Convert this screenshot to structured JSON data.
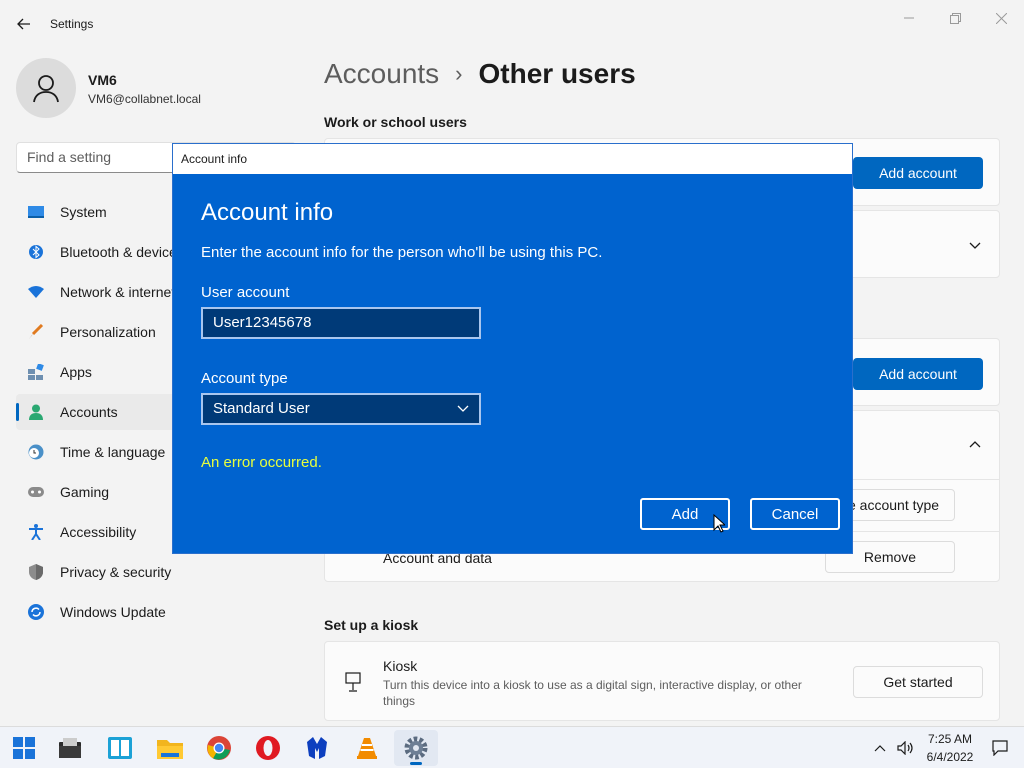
{
  "window": {
    "title": "Settings"
  },
  "profile": {
    "name": "VM6",
    "email": "VM6@collabnet.local"
  },
  "search": {
    "placeholder": "Find a setting"
  },
  "nav": {
    "items": [
      {
        "label": "System",
        "icon": "monitor-icon"
      },
      {
        "label": "Bluetooth & devices",
        "icon": "bluetooth-icon"
      },
      {
        "label": "Network & internet",
        "icon": "wifi-icon"
      },
      {
        "label": "Personalization",
        "icon": "brush-icon"
      },
      {
        "label": "Apps",
        "icon": "apps-icon"
      },
      {
        "label": "Accounts",
        "icon": "person-icon",
        "active": true
      },
      {
        "label": "Time & language",
        "icon": "clock-globe-icon"
      },
      {
        "label": "Gaming",
        "icon": "gamepad-icon"
      },
      {
        "label": "Accessibility",
        "icon": "accessibility-icon"
      },
      {
        "label": "Privacy & security",
        "icon": "shield-icon"
      },
      {
        "label": "Windows Update",
        "icon": "update-icon"
      }
    ]
  },
  "breadcrumb": {
    "parent": "Accounts",
    "separator": "›",
    "current": "Other users"
  },
  "content": {
    "work_section_title": "Work or school users",
    "add_account_label": "Add account",
    "change_account_type_label": "e account type",
    "account_and_data_label": "Account and data",
    "remove_label": "Remove",
    "kiosk_section_title": "Set up a kiosk",
    "kiosk_title": "Kiosk",
    "kiosk_desc": "Turn this device into a kiosk to use as a digital sign, interactive display, or other things",
    "get_started_label": "Get started"
  },
  "dialog": {
    "window_title": "Account info",
    "heading": "Account info",
    "description": "Enter the account info for the person who'll be using this PC.",
    "user_account_label": "User account",
    "user_account_value": "User12345678",
    "account_type_label": "Account type",
    "account_type_value": "Standard User",
    "error_text": "An error occurred.",
    "add_label": "Add",
    "cancel_label": "Cancel"
  },
  "taskbar": {
    "apps": [
      "windows-start-icon",
      "file-manager-icon",
      "widgets-icon",
      "file-explorer-icon",
      "chrome-icon",
      "opera-icon",
      "malwarebytes-icon",
      "vlc-icon",
      "settings-gear-icon"
    ],
    "time": "7:25 AM",
    "date": "6/4/2022"
  },
  "colors": {
    "accent": "#0067c0",
    "dialog_bg": "#0063cf",
    "error": "#e8ff3d"
  }
}
